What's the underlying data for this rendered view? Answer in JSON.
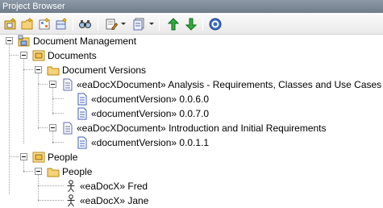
{
  "window": {
    "title": "Project Browser"
  },
  "toolbar": {
    "icons": [
      "new-model-icon",
      "new-package-icon",
      "new-diagram-icon",
      "new-element-icon",
      "find-icon",
      "edit-dropdown-icon",
      "view-dropdown-icon",
      "move-up-icon",
      "move-down-icon",
      "help-icon"
    ]
  },
  "tree": {
    "root": {
      "label": "Document Management",
      "icon": "model-root-icon"
    },
    "documents": {
      "label": "Documents",
      "icon": "package-icon"
    },
    "document_versions": {
      "label": "Document Versions",
      "icon": "folder-icon"
    },
    "doc1": {
      "label": "«eaDocXDocument» Analysis - Requirements, Classes and Use Cases",
      "icon": "document-icon"
    },
    "doc1_v1": {
      "label": "«documentVersion» 0.0.6.0",
      "icon": "document-version-icon"
    },
    "doc1_v2": {
      "label": "«documentVersion» 0.0.7.0",
      "icon": "document-version-icon"
    },
    "doc2": {
      "label": "«eaDocXDocument» Introduction and Initial Requirements",
      "icon": "document-icon"
    },
    "doc2_v1": {
      "label": "«documentVersion» 0.0.1.1",
      "icon": "document-version-icon"
    },
    "people": {
      "label": "People",
      "icon": "package-icon"
    },
    "people_folder": {
      "label": "People",
      "icon": "folder-icon"
    },
    "fred": {
      "label": "«eaDocX» Fred",
      "icon": "actor-icon"
    },
    "jane": {
      "label": "«eaDocX» Jane",
      "icon": "actor-icon"
    }
  },
  "colors": {
    "titlebar": "#7a8795",
    "folder": "#f6d27a",
    "package_border": "#b8860b",
    "up_arrow": "#1e9a2e",
    "down_arrow": "#1e9a2e",
    "help": "#2d5ca8"
  }
}
